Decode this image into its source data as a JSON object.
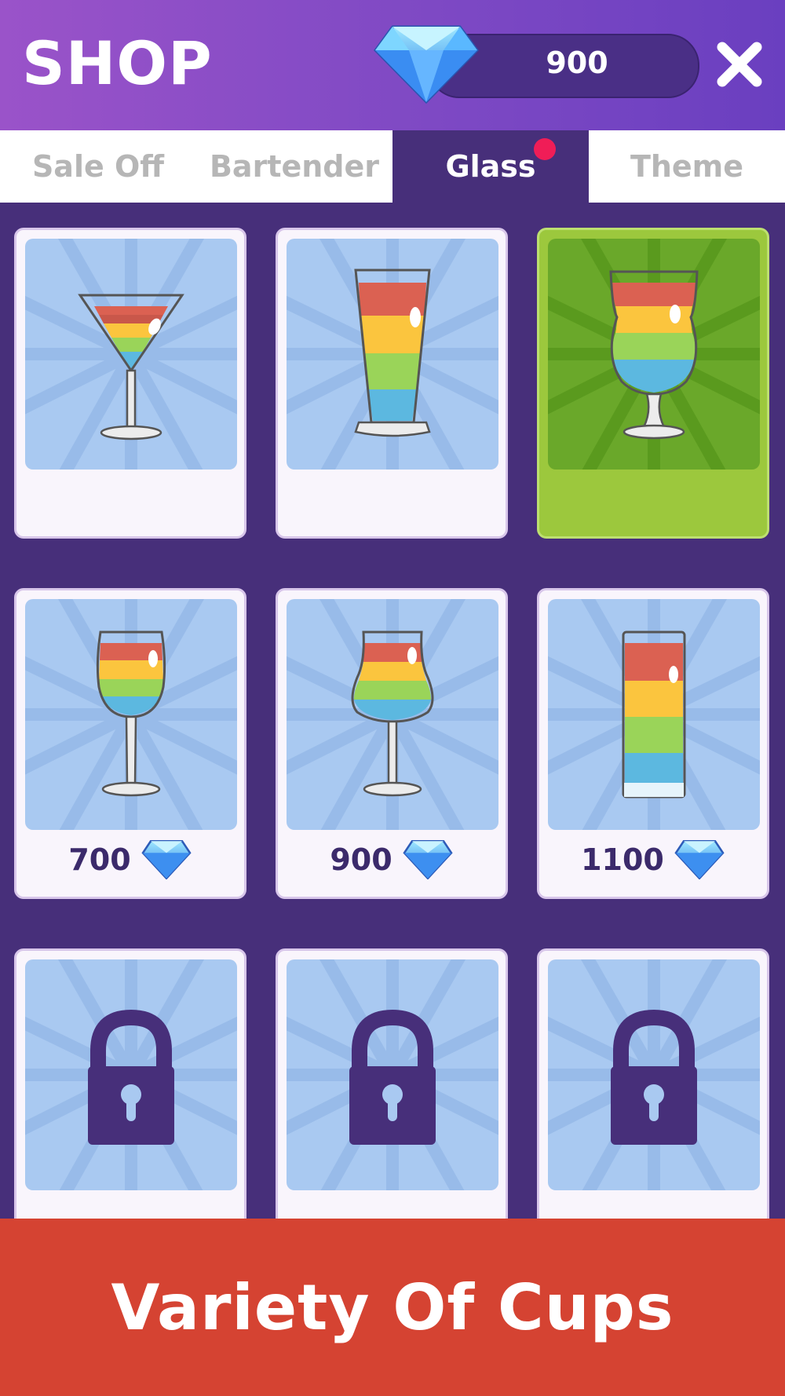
{
  "header": {
    "title": "SHOP",
    "gem_count": "900",
    "gem_icon": "diamond-icon",
    "close_icon": "close-icon"
  },
  "tabs": [
    {
      "label": "Sale Off",
      "active": false
    },
    {
      "label": "Bartender",
      "active": false
    },
    {
      "label": "Glass",
      "active": true,
      "notification": true
    },
    {
      "label": "Theme",
      "active": false
    }
  ],
  "items": [
    {
      "glass": "martini-glass-icon",
      "price": null,
      "state": "owned"
    },
    {
      "glass": "pilsner-glass-icon",
      "price": null,
      "state": "owned"
    },
    {
      "glass": "hurricane-glass-icon",
      "price": null,
      "state": "selected"
    },
    {
      "glass": "wine-glass-icon",
      "price": "700",
      "state": "for-sale"
    },
    {
      "glass": "tulip-glass-icon",
      "price": "900",
      "state": "for-sale"
    },
    {
      "glass": "highball-glass-icon",
      "price": "1100",
      "state": "for-sale"
    },
    {
      "glass": "lock-icon",
      "price": null,
      "state": "locked"
    },
    {
      "glass": "lock-icon",
      "price": null,
      "state": "locked"
    },
    {
      "glass": "lock-icon",
      "price": null,
      "state": "locked"
    }
  ],
  "banner": {
    "text": "Variety Of Cups"
  },
  "colors": {
    "header_start": "#9a53c9",
    "header_end": "#6a3fc0",
    "background": "#472f7a",
    "selected_card": "#9cc83d",
    "banner": "#d54332",
    "notification_dot": "#f01d57",
    "liquid_red": "#db6152",
    "liquid_yellow": "#fbc53e",
    "liquid_green": "#9ad459",
    "liquid_blue": "#5cb8e0"
  }
}
